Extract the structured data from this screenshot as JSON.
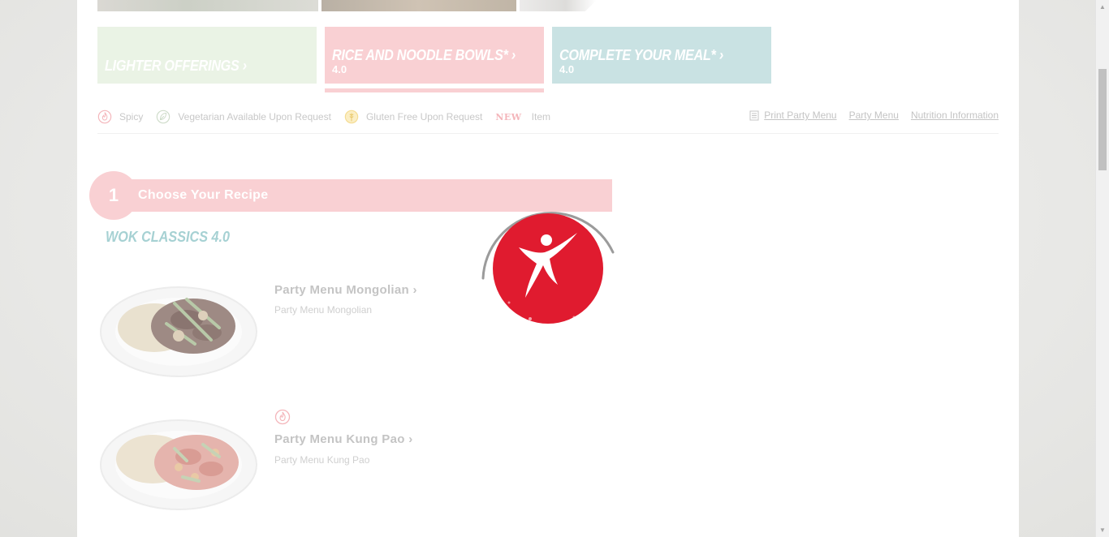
{
  "categories": [
    {
      "title": "LIGHTER OFFERINGS",
      "chevron": "›",
      "version": ""
    },
    {
      "title": "RICE AND NOODLE BOWLS*",
      "chevron": "›",
      "version": "4.0"
    },
    {
      "title": "COMPLETE YOUR MEAL*",
      "chevron": "›",
      "version": "4.0"
    }
  ],
  "legend": {
    "spicy": "Spicy",
    "vegetarian": "Vegetarian Available Upon Request",
    "gluten_free": "Gluten Free Upon Request",
    "new_badge": "NEW",
    "new_item": "Item"
  },
  "links": {
    "print_party_menu": "Print Party Menu",
    "party_menu": "Party Menu",
    "nutrition_information": "Nutrition Information"
  },
  "step": {
    "number": "1",
    "label": "Choose Your Recipe"
  },
  "section_title": "WOK CLASSICS 4.0",
  "menu_items": [
    {
      "name": "Party Menu Mongolian",
      "chevron": "›",
      "description": "Party Menu Mongolian",
      "spicy": false
    },
    {
      "name": "Party Menu Kung Pao",
      "chevron": "›",
      "description": "Party Menu Kung Pao",
      "spicy": true
    }
  ],
  "icons": {
    "spicy": "flame-icon",
    "vegetarian": "leaf-icon",
    "gluten_free": "wheat-icon",
    "print": "print-icon",
    "loader_logo": "dancer-logo-icon"
  },
  "colors": {
    "brand_red": "#e01b2f",
    "pink_tint": "#f9d0d3",
    "teal_tint": "#c9e2e3",
    "green_tint": "#eaf3e5",
    "section_teal": "#a6d1d3"
  }
}
